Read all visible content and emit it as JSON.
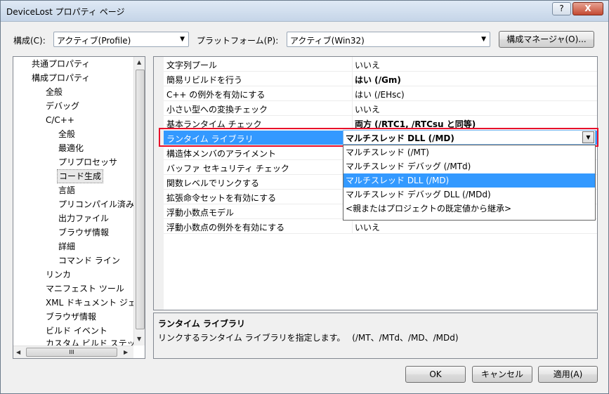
{
  "window": {
    "title": "DeviceLost プロパティ ページ",
    "help_btn": "?",
    "close_btn": "X"
  },
  "toolbar": {
    "config_label": "構成(C):",
    "config_value": "アクティブ(Profile)",
    "platform_label": "プラットフォーム(P):",
    "platform_value": "アクティブ(Win32)",
    "config_manager": "構成マネージャ(O)..."
  },
  "tree": {
    "items": [
      "共通プロパティ",
      "構成プロパティ",
      "全般",
      "デバッグ",
      "C/C++",
      "全般",
      "最適化",
      "プリプロセッサ",
      "コード生成",
      "言語",
      "プリコンパイル済み",
      "出力ファイル",
      "ブラウザ情報",
      "詳細",
      "コマンド ライン",
      "リンカ",
      "マニフェスト ツール",
      "XML ドキュメント ジェ",
      "ブラウザ情報",
      "ビルド イベント",
      "カスタム ビルド ステッ"
    ],
    "hscroll_grip": "III"
  },
  "grid": {
    "rows": [
      {
        "name": "文字列プール",
        "value": "いいえ"
      },
      {
        "name": "簡易リビルドを行う",
        "value": "はい (/Gm)"
      },
      {
        "name": "C++ の例外を有効にする",
        "value": "はい (/EHsc)"
      },
      {
        "name": "小さい型への変換チェック",
        "value": "いいえ"
      },
      {
        "name": "基本ランタイム チェック",
        "value": "両方 (/RTC1, /RTCsu と同等)"
      },
      {
        "name": "ランタイム ライブラリ",
        "value": "マルチスレッド DLL (/MD)"
      },
      {
        "name": "構造体メンバのアライメント",
        "value": ""
      },
      {
        "name": "バッファ セキュリティ チェック",
        "value": ""
      },
      {
        "name": "関数レベルでリンクする",
        "value": ""
      },
      {
        "name": "拡張命令セットを有効にする",
        "value": ""
      },
      {
        "name": "浮動小数点モデル",
        "value": ""
      },
      {
        "name": "浮動小数点の例外を有効にする",
        "value": "いいえ"
      }
    ]
  },
  "dropdown": {
    "options": [
      "マルチスレッド (/MT)",
      "マルチスレッド デバッグ (/MTd)",
      "マルチスレッド DLL (/MD)",
      "マルチスレッド デバッグ DLL (/MDd)",
      "<親またはプロジェクトの既定値から継承>"
    ]
  },
  "description": {
    "title": "ランタイム ライブラリ",
    "text": "リンクするランタイム ライブラリを指定します。　 (/MT、/MTd、/MD、/MDd)"
  },
  "buttons": {
    "ok": "OK",
    "cancel": "キャンセル",
    "apply": "適用(A)"
  }
}
